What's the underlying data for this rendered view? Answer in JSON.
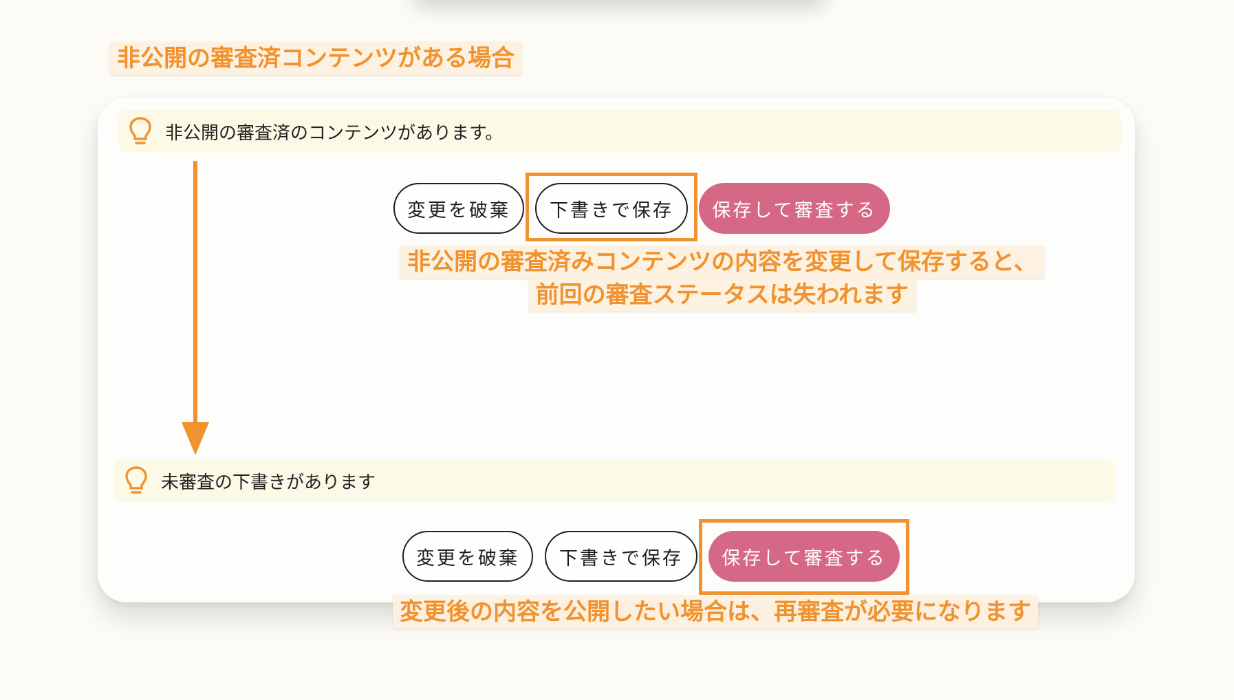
{
  "annotations": {
    "heading": "非公開の審査済コンテンツがある場合",
    "note_top_line1": "非公開の審査済みコンテンツの内容を変更して保存すると、",
    "note_top_line2": "前回の審査ステータスは失われます",
    "note_bottom": "変更後の内容を公開したい場合は、再審査が必要になります"
  },
  "state_before": {
    "notice": "非公開の審査済のコンテンツがあります。",
    "notice_icon": "lightbulb-icon",
    "buttons": {
      "discard": "変更を破棄",
      "save_draft": "下書きで保存",
      "save_review": "保存して審査する"
    }
  },
  "state_after": {
    "notice": "未審査の下書きがあります",
    "notice_icon": "lightbulb-icon",
    "buttons": {
      "discard": "変更を破棄",
      "save_draft": "下書きで保存",
      "save_review": "保存して審査する"
    }
  },
  "colors": {
    "accent_orange": "#f0922e",
    "primary_button": "#d46885",
    "notice_bg": "#fdf9e7",
    "panel_bg": "#fdfdfc",
    "page_bg": "#fcfbf6"
  }
}
